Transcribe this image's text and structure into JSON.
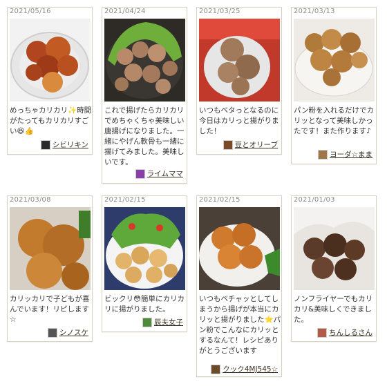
{
  "cards": [
    {
      "date": "2021/05/16",
      "text": "めっちゃカリカリ✨時間がたってもカリカリすごい😆👍",
      "author": "シビリキン",
      "avatar_color": "#2a2a2a"
    },
    {
      "date": "2021/04/24",
      "text": "これで揚げたらカリカリでめちゃくちゃ美味しい唐揚げになりました。一緒にやげん軟骨も一緒に揚げてみました。美味しいです。",
      "author": "ライムママ",
      "avatar_color": "#8a3fa8"
    },
    {
      "date": "2021/03/25",
      "text": "いつもベタっとなるのに今日はカリっと揚がりました！",
      "author": "豆とオリーブ",
      "avatar_color": "#7a4a2a"
    },
    {
      "date": "2021/03/13",
      "text": "パン粉を入れるだけでカリッとなって美味しかったです！また作ります♪",
      "author": "ヨーダ☆まま",
      "avatar_color": "#a0754a"
    },
    {
      "date": "2021/03/08",
      "text": "カリッカリで子どもが喜んでいます！リピします☆",
      "author": "シノスケ",
      "avatar_color": "#555555"
    },
    {
      "date": "2021/02/15",
      "text": "ビックリ😳簡単にカリカリに揚がりました。",
      "author": "辰夫女子",
      "avatar_color": "#4f8a3a"
    },
    {
      "date": "2021/02/15",
      "text": "いつもベチャッとしてしまうから揚げが本当にカリッと揚がりました⭐パン粉でこんなにカリッとするなんて！レシピありがとうございます",
      "author": "クック4MJ545☆",
      "avatar_color": "#6b4a2a"
    },
    {
      "date": "2021/01/03",
      "text": "ノンフライヤーでもカリカリ&美味しくできました。",
      "author": "ちんしるさん",
      "avatar_color": "#b05a4a"
    }
  ]
}
